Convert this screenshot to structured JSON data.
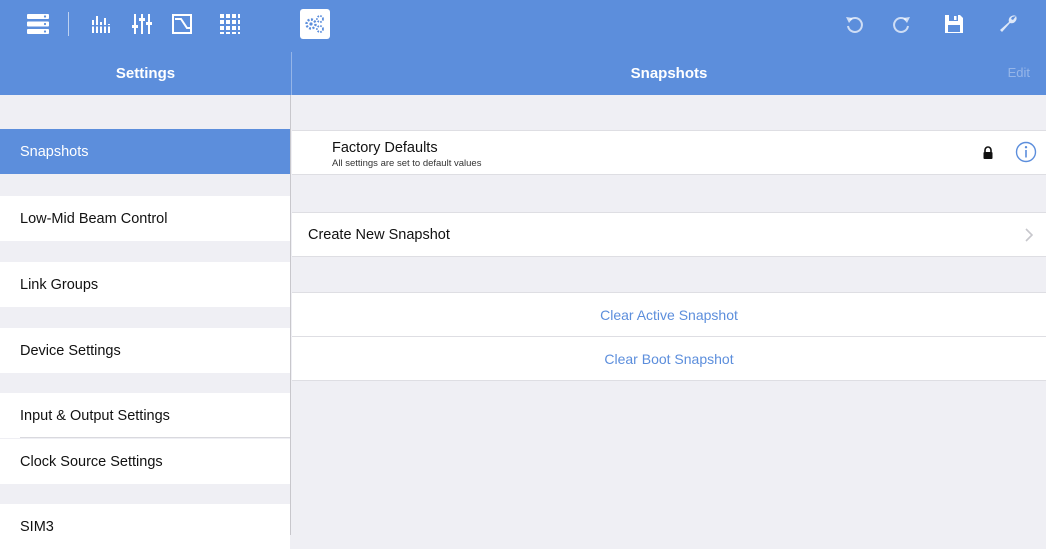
{
  "toolbar": {
    "left_icons": [
      "device-list-icon",
      "eq-graph-icon",
      "mixer-sliders-icon",
      "waveform-box-icon",
      "matrix-grid-icon",
      "settings-gears-icon"
    ],
    "right_icons": [
      "undo-icon",
      "redo-icon",
      "save-disk-icon",
      "wrench-icon"
    ],
    "accent_color": "#5c8edc"
  },
  "header": {
    "left_title": "Settings",
    "right_title": "Snapshots",
    "edit_label": "Edit"
  },
  "sidebar": {
    "items": [
      {
        "label": "Snapshots",
        "selected": true
      },
      {
        "label": "Low-Mid Beam Control",
        "selected": false
      },
      {
        "label": "Link Groups",
        "selected": false
      },
      {
        "label": "Device Settings",
        "selected": false
      },
      {
        "label": "Input & Output Settings",
        "selected": false
      },
      {
        "label": "Clock Source Settings",
        "selected": false
      },
      {
        "label": "SIM3",
        "selected": false
      }
    ]
  },
  "snapshots": {
    "factory": {
      "title": "Factory Defaults",
      "subtitle": "All settings are set to default values",
      "locked": true
    },
    "create_label": "Create New Snapshot",
    "clear_active_label": "Clear Active Snapshot",
    "clear_boot_label": "Clear Boot Snapshot"
  }
}
